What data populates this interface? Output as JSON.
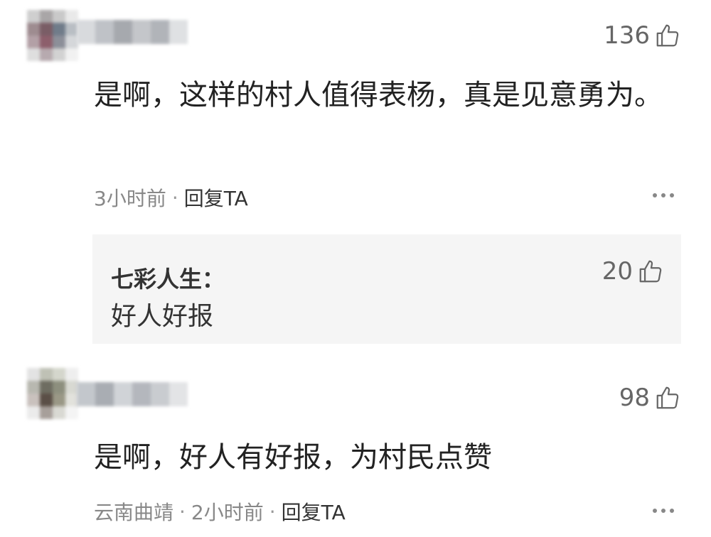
{
  "icons": {
    "like": "thumbs-up-icon",
    "more": "more-horizontal-icon"
  },
  "comments": [
    {
      "likes": "136",
      "text": "是啊，这样的村人值得表杨，真是见意勇为。",
      "time": "3小时前",
      "separator": "·",
      "reply_label": "回复TA",
      "replies": [
        {
          "author": "七彩人生：",
          "text": "好人好报",
          "likes": "20"
        }
      ]
    },
    {
      "likes": "98",
      "text": "是啊，好人有好报，为村民点赞",
      "location": "云南曲靖",
      "time": "2小时前",
      "separator": "·",
      "reply_label": "回复TA"
    }
  ]
}
